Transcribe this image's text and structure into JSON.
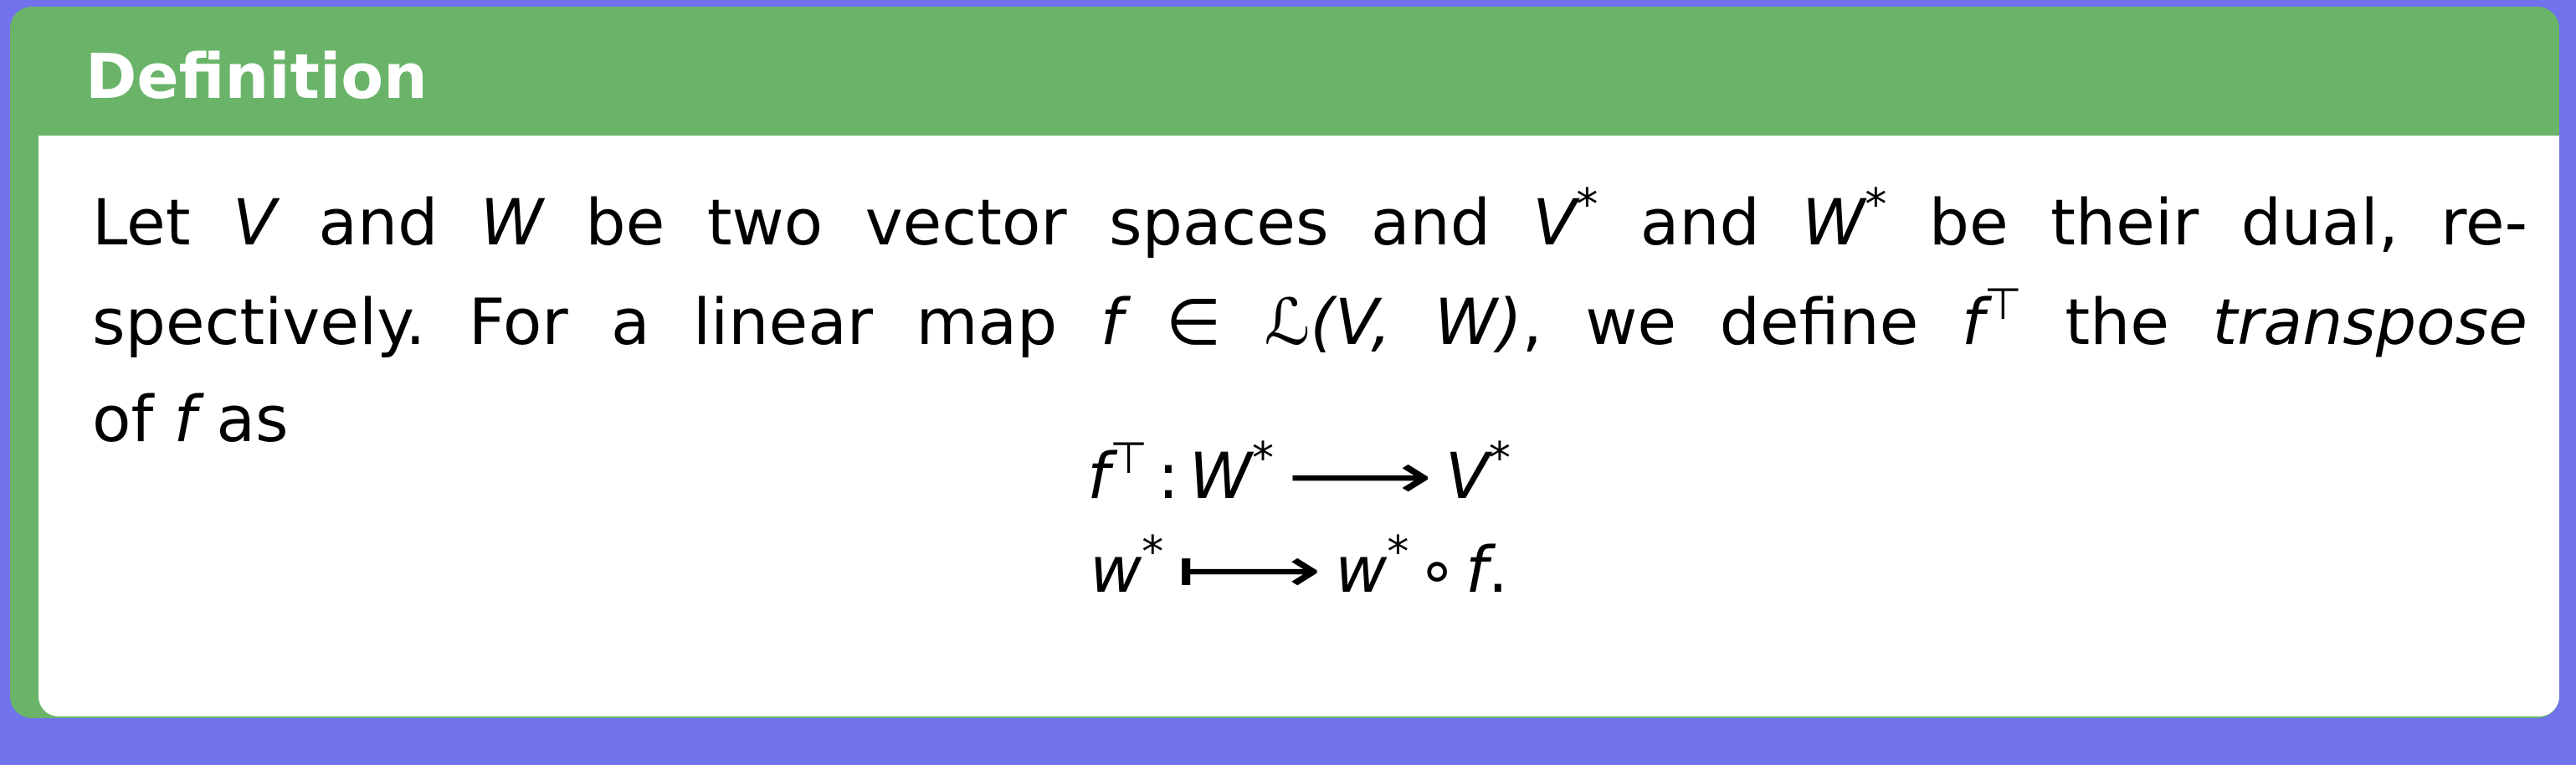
{
  "definition": {
    "title": "Definition",
    "line1": {
      "let": "Let",
      "V": "V",
      "and1": "and",
      "W": "W",
      "mid": "be two vector spaces and",
      "Vstar": "V",
      "star1": "*",
      "and2": "and",
      "Wstar": "W",
      "star2": "*",
      "end": "be their dual, re-"
    },
    "line2": {
      "start": "spectively. For a linear map",
      "f": "f",
      "in": "∈",
      "L": "ℒ",
      "args": "(V, W)",
      "mid": ", we define",
      "fT": "f",
      "T": "⊤",
      "the": "the",
      "transpose": "transpose"
    },
    "line3": {
      "of": "of",
      "f": "f",
      "as": "as"
    },
    "eq1": {
      "f": "f",
      "T": "⊤",
      "colon": ":",
      "W": "W",
      "star1": "*",
      "arrow": "⟶",
      "V": "V",
      "star2": "*"
    },
    "eq2": {
      "w": "w",
      "star1": "*",
      "mapsto": "⟼",
      "w2": "w",
      "star2": "*",
      "circ": "∘",
      "f": "f",
      "period": "."
    }
  }
}
